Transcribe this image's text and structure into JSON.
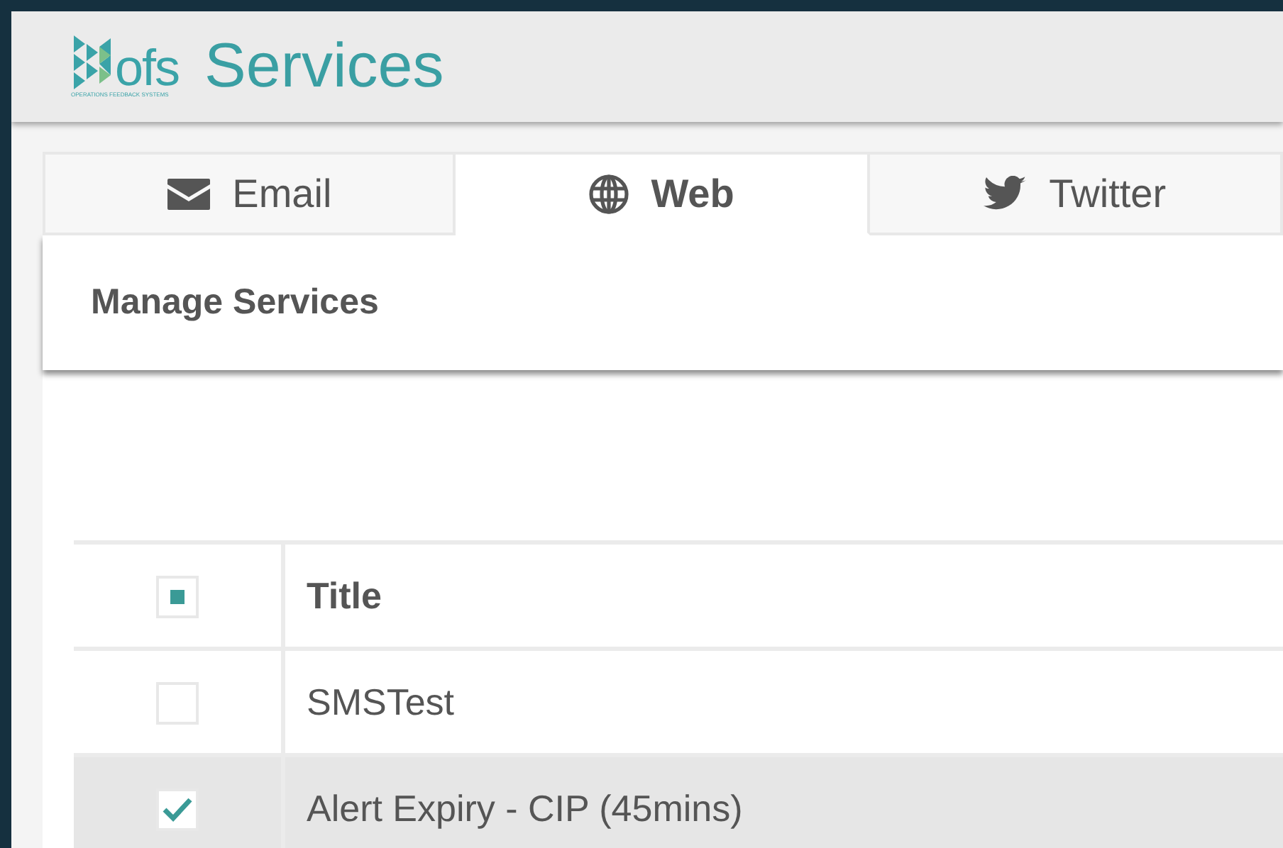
{
  "header": {
    "logo_text": "ofs",
    "logo_tagline": "OPERATIONS FEEDBACK SYSTEMS",
    "title": "Services"
  },
  "tabs": [
    {
      "label": "Email",
      "kind": "email",
      "selected": false
    },
    {
      "label": "Web",
      "kind": "web",
      "selected": true
    },
    {
      "label": "Twitter",
      "kind": "twitter",
      "selected": false
    }
  ],
  "panel": {
    "title": "Manage Services"
  },
  "table": {
    "select_all": {
      "indeterminate": true
    },
    "columns": [
      "Title"
    ],
    "rows": [
      {
        "title": "SMSTest",
        "checked": false,
        "selected": false
      },
      {
        "title": "Alert Expiry - CIP (45mins)",
        "checked": true,
        "selected": true
      }
    ]
  }
}
